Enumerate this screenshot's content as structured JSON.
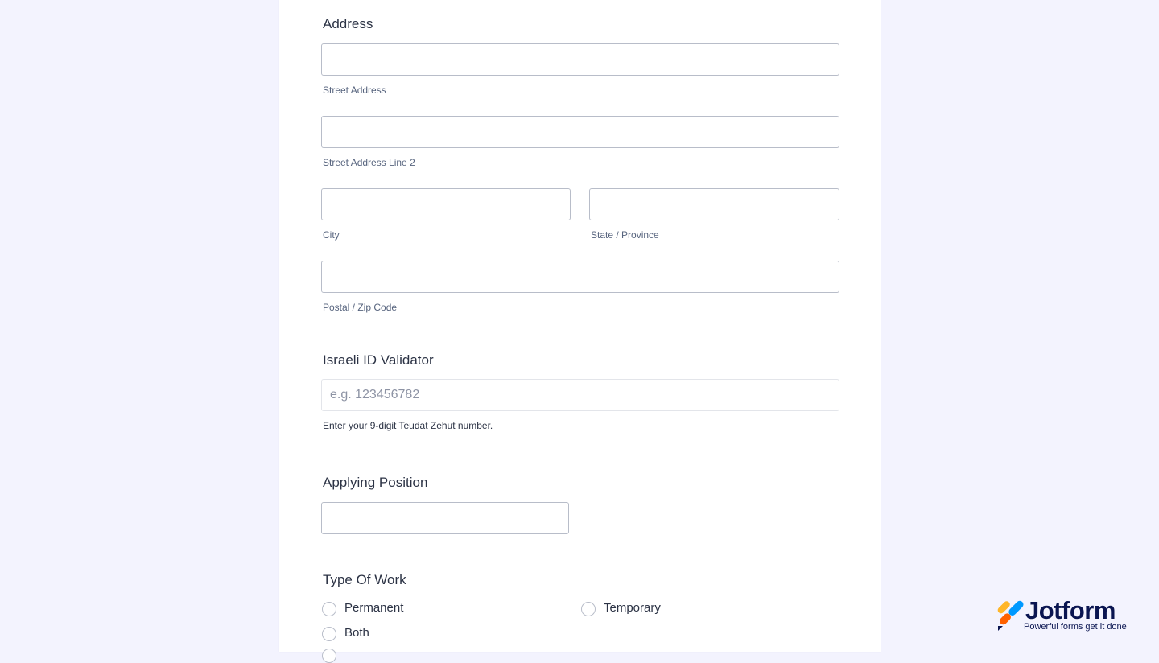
{
  "address": {
    "label": "Address",
    "street_sub": "Street Address",
    "street2_sub": "Street Address Line 2",
    "city_sub": "City",
    "state_sub": "State / Province",
    "zip_sub": "Postal / Zip Code",
    "street_value": "",
    "street2_value": "",
    "city_value": "",
    "state_value": "",
    "zip_value": ""
  },
  "israeli_id": {
    "label": "Israeli ID Validator",
    "placeholder": "e.g. 123456782",
    "value": "",
    "hint": "Enter your 9-digit Teudat Zehut number."
  },
  "position": {
    "label": "Applying Position",
    "value": ""
  },
  "work_type": {
    "label": "Type Of Work",
    "options": [
      "Permanent",
      "Temporary",
      "Both"
    ],
    "selected": null
  },
  "brand": {
    "name": "Jotform",
    "tagline": "Powerful forms get it done",
    "colors": {
      "blue": "#0099ff",
      "orange": "#ff6100",
      "yellow": "#ffb629",
      "navy": "#0a1551"
    }
  },
  "colors": {
    "page_bg": "#f3f3fe",
    "card_bg": "#ffffff",
    "text": "#2c3345",
    "sublabel": "#57647e",
    "border": "#b8bdc9"
  }
}
